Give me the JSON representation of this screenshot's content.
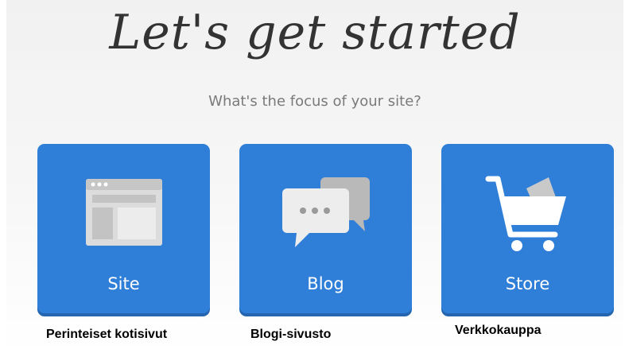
{
  "header": {
    "title": "Let's get started",
    "subtitle": "What's the focus of your site?"
  },
  "cards": [
    {
      "label": "Site",
      "icon": "browser-window-icon",
      "caption": "Perinteiset kotisivut"
    },
    {
      "label": "Blog",
      "icon": "chat-bubbles-icon",
      "caption": "Blogi-sivusto"
    },
    {
      "label": "Store",
      "icon": "shopping-cart-icon",
      "caption": "Verkkokauppa"
    }
  ],
  "colors": {
    "card": "#2f7fd9",
    "card_shadow": "#2565b0",
    "title": "#333333",
    "subtitle": "#7a7a7a"
  }
}
